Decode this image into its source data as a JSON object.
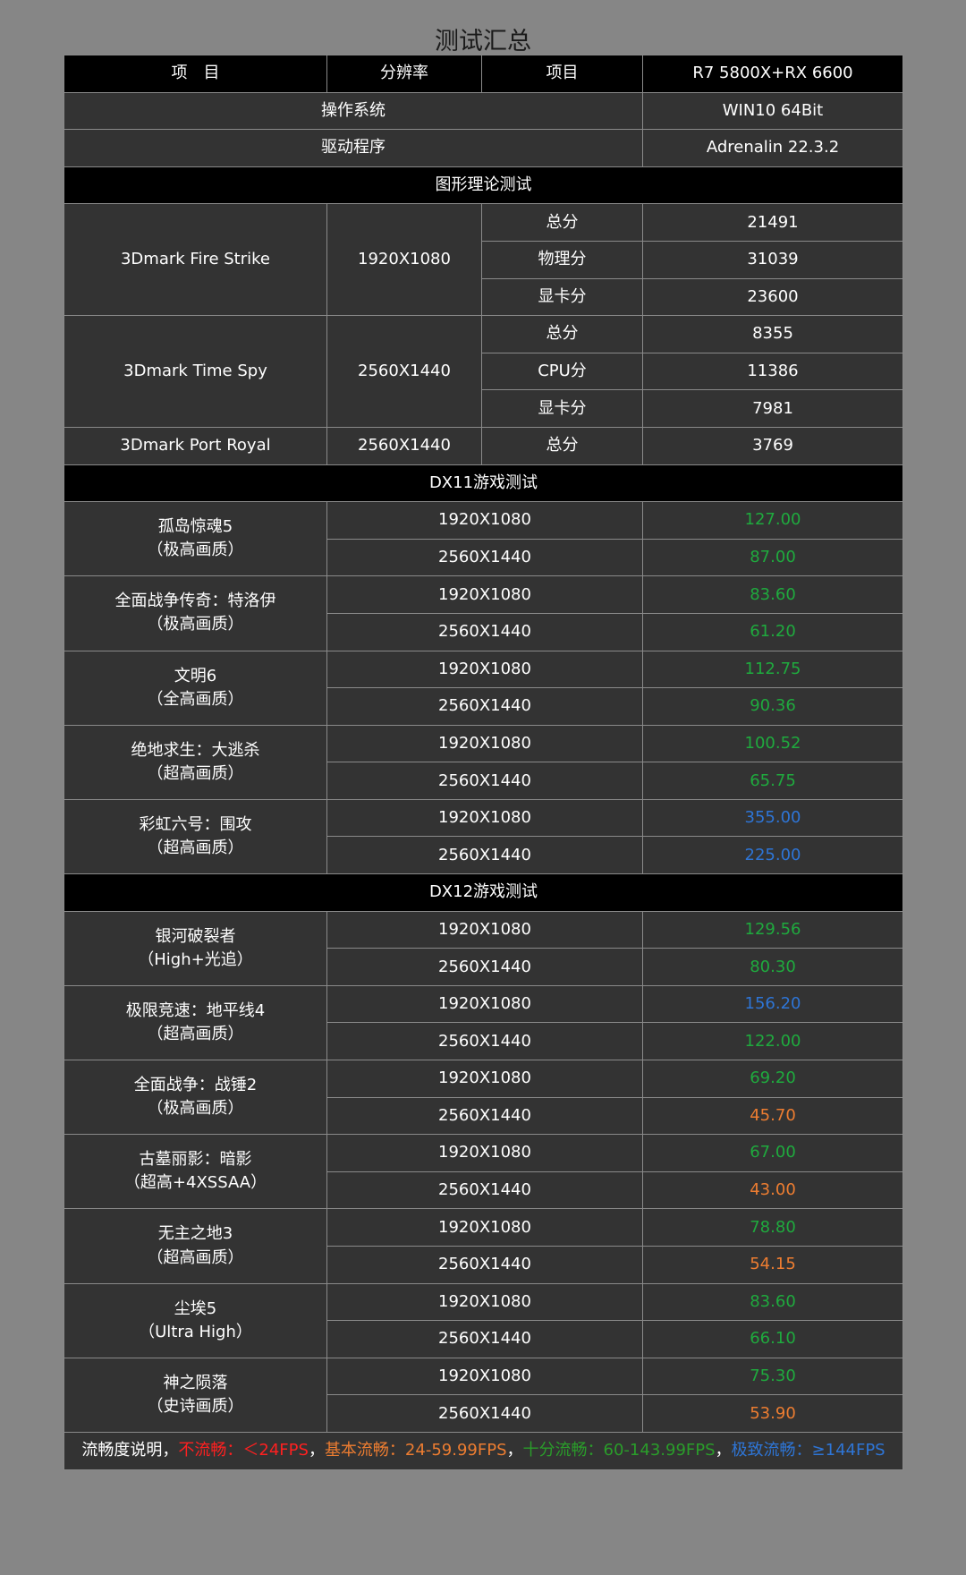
{
  "title": "测试汇总",
  "colors": {
    "green": "#1faa3e",
    "orange": "#ed7d31",
    "blue": "#2e75d6",
    "red": "#ff2020"
  },
  "header": {
    "col1": "项　目",
    "col2": "分辨率",
    "col3": "项目",
    "col4": "R7 5800X+RX 6600"
  },
  "system": {
    "os_label": "操作系统",
    "os_value": "WIN10 64Bit",
    "driver_label": "驱动程序",
    "driver_value": "Adrenalin 22.3.2"
  },
  "sections": {
    "theory": "图形理论测试",
    "dx11": "DX11游戏测试",
    "dx12": "DX12游戏测试"
  },
  "theory": {
    "fire_strike": {
      "name": "3Dmark Fire Strike",
      "res": "1920X1080",
      "rows": [
        {
          "label": "总分",
          "value": "21491"
        },
        {
          "label": "物理分",
          "value": "31039"
        },
        {
          "label": "显卡分",
          "value": "23600"
        }
      ]
    },
    "time_spy": {
      "name": "3Dmark Time Spy",
      "res": "2560X1440",
      "rows": [
        {
          "label": "总分",
          "value": "8355"
        },
        {
          "label": "CPU分",
          "value": "11386"
        },
        {
          "label": "显卡分",
          "value": "7981"
        }
      ]
    },
    "port_royal": {
      "name": "3Dmark Port Royal",
      "res": "2560X1440",
      "label": "总分",
      "value": "3769"
    }
  },
  "dx11": [
    {
      "name1": "孤岛惊魂5",
      "name2": "（极高画质）",
      "r1": "1920X1080",
      "v1": "127.00",
      "c1": "green",
      "r2": "2560X1440",
      "v2": "87.00",
      "c2": "green"
    },
    {
      "name1": "全面战争传奇：特洛伊",
      "name2": "（极高画质）",
      "r1": "1920X1080",
      "v1": "83.60",
      "c1": "green",
      "r2": "2560X1440",
      "v2": "61.20",
      "c2": "green"
    },
    {
      "name1": "文明6",
      "name2": "（全高画质）",
      "r1": "1920X1080",
      "v1": "112.75",
      "c1": "green",
      "r2": "2560X1440",
      "v2": "90.36",
      "c2": "green"
    },
    {
      "name1": "绝地求生：大逃杀",
      "name2": "（超高画质）",
      "r1": "1920X1080",
      "v1": "100.52",
      "c1": "green",
      "r2": "2560X1440",
      "v2": "65.75",
      "c2": "green"
    },
    {
      "name1": "彩虹六号：围攻",
      "name2": "（超高画质）",
      "r1": "1920X1080",
      "v1": "355.00",
      "c1": "blue",
      "r2": "2560X1440",
      "v2": "225.00",
      "c2": "blue"
    }
  ],
  "dx12": [
    {
      "name1": "银河破裂者",
      "name2": "（High+光追）",
      "r1": "1920X1080",
      "v1": "129.56",
      "c1": "green",
      "r2": "2560X1440",
      "v2": "80.30",
      "c2": "green"
    },
    {
      "name1": "极限竞速：地平线4",
      "name2": "（超高画质）",
      "r1": "1920X1080",
      "v1": "156.20",
      "c1": "blue",
      "r2": "2560X1440",
      "v2": "122.00",
      "c2": "green"
    },
    {
      "name1": "全面战争：战锤2",
      "name2": "（极高画质）",
      "r1": "1920X1080",
      "v1": "69.20",
      "c1": "green",
      "r2": "2560X1440",
      "v2": "45.70",
      "c2": "orange"
    },
    {
      "name1": "古墓丽影：暗影",
      "name2": "（超高+4XSSAA）",
      "r1": "1920X1080",
      "v1": "67.00",
      "c1": "green",
      "r2": "2560X1440",
      "v2": "43.00",
      "c2": "orange"
    },
    {
      "name1": "无主之地3",
      "name2": "（超高画质）",
      "r1": "1920X1080",
      "v1": "78.80",
      "c1": "green",
      "r2": "2560X1440",
      "v2": "54.15",
      "c2": "orange"
    },
    {
      "name1": "尘埃5",
      "name2": "（Ultra High）",
      "r1": "1920X1080",
      "v1": "83.60",
      "c1": "green",
      "r2": "2560X1440",
      "v2": "66.10",
      "c2": "green"
    },
    {
      "name1": "神之陨落",
      "name2": "（史诗画质）",
      "r1": "1920X1080",
      "v1": "75.30",
      "c1": "green",
      "r2": "2560X1440",
      "v2": "53.90",
      "c2": "orange"
    }
  ],
  "legend": {
    "prefix": "流畅度说明，",
    "bad": "不流畅：＜24FPS",
    "sep1": "，",
    "basic": "基本流畅：24-59.99FPS",
    "sep2": "，",
    "smooth": "十分流畅：60-143.99FPS",
    "sep3": "，",
    "extreme": "极致流畅：≥144FPS"
  }
}
